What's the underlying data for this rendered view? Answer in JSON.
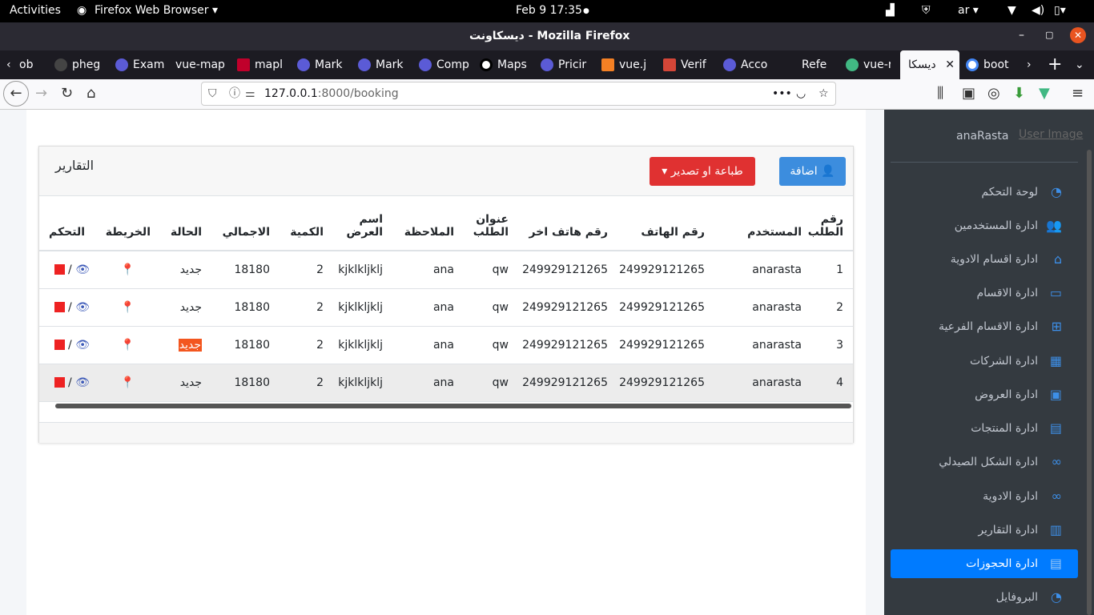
{
  "system": {
    "activities": "Activities",
    "app": "Firefox Web Browser",
    "clock": "Feb 9  17:35",
    "lang": "ar"
  },
  "window": {
    "title": "ديسكاونت - Mozilla Firefox"
  },
  "tabs": [
    "ob",
    "pheg",
    "Exam",
    "vue-map",
    "mapl",
    "Mark",
    "Mark",
    "Comp",
    "Maps",
    "Pricir",
    "vue.j",
    "Verif",
    "Acco",
    "Refe",
    "vue-r",
    "ديسكا",
    "boot"
  ],
  "url": {
    "host": "127.0.0.1",
    "rest": ":8000/booking"
  },
  "card": {
    "title": "التقارير",
    "add_label": "اضافة",
    "export_label": "طباعة او تصدير"
  },
  "table": {
    "headers": [
      "رقم الطلب",
      "المستخدم",
      "رقم الهاتف",
      "رقم هاتف اخر",
      "عنوان الطلب",
      "الملاحظة",
      "اسم العرض",
      "الكمية",
      "الاجمالي",
      "الحالة",
      "الخريطة",
      "التحكم"
    ],
    "rows": [
      {
        "id": "1",
        "user": "anarasta",
        "phone": "249929121265",
        "phone2": "249929121265",
        "address": "qw",
        "note": "ana",
        "offer": "kjklkljklj",
        "qty": "2",
        "total": "18180",
        "status": "جديد"
      },
      {
        "id": "2",
        "user": "anarasta",
        "phone": "249929121265",
        "phone2": "249929121265",
        "address": "qw",
        "note": "ana",
        "offer": "kjklkljklj",
        "qty": "2",
        "total": "18180",
        "status": "جديد"
      },
      {
        "id": "3",
        "user": "anarasta",
        "phone": "249929121265",
        "phone2": "249929121265",
        "address": "qw",
        "note": "ana",
        "offer": "kjklkljklj",
        "qty": "2",
        "total": "18180",
        "status": "جديد"
      },
      {
        "id": "4",
        "user": "anarasta",
        "phone": "249929121265",
        "phone2": "249929121265",
        "address": "qw",
        "note": "ana",
        "offer": "kjklkljklj",
        "qty": "2",
        "total": "18180",
        "status": "جديد"
      }
    ],
    "separator": "/"
  },
  "sidebar": {
    "user_name": "anaRasta",
    "user_image_alt": "User Image",
    "items": [
      "لوحة التحكم",
      "ادارة المستخدمين",
      "ادارة اقسام الادوية",
      "ادارة الاقسام",
      "ادارة الاقسام الفرعية",
      "ادارة الشركات",
      "ادارة العروض",
      "ادارة المنتجات",
      "ادارة الشكل الصيدلي",
      "ادارة الادوية",
      "ادارة التقارير",
      "ادارة الحجوزات",
      "البروفايل"
    ]
  },
  "colors": {
    "accent": "#007bff",
    "add_button": "#3c8dde",
    "export_button": "#e03131",
    "sidebar_bg": "#343a40",
    "status_highlight": "#f3561f"
  }
}
